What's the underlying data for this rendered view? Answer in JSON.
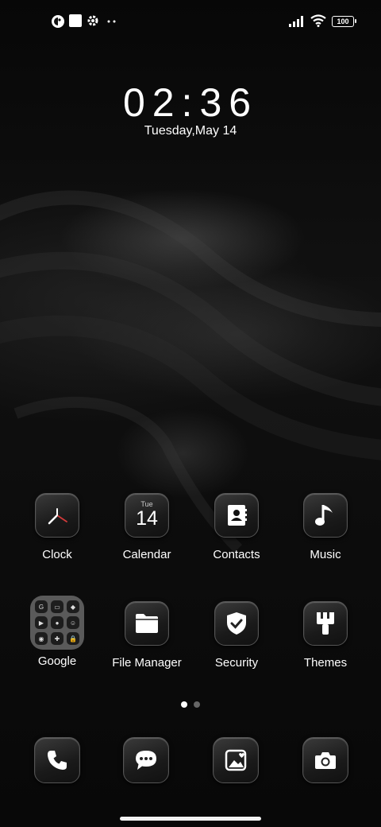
{
  "status_bar": {
    "battery": "100",
    "left_icons": [
      "theme-icon",
      "square-icon",
      "gear-icon",
      "more-dots-icon"
    ],
    "right_icons": [
      "signal-icon",
      "wifi-icon",
      "battery-icon"
    ]
  },
  "clock": {
    "time": "02:36",
    "date": "Tuesday,May 14"
  },
  "apps_row1": [
    {
      "label": "Clock",
      "icon": "clock-icon"
    },
    {
      "label": "Calendar",
      "icon": "calendar-icon",
      "day": "Tue",
      "num": "14"
    },
    {
      "label": "Contacts",
      "icon": "contacts-icon"
    },
    {
      "label": "Music",
      "icon": "music-note-icon"
    }
  ],
  "apps_row2": [
    {
      "label": "Google",
      "icon": "folder-icon"
    },
    {
      "label": "File Manager",
      "icon": "file-folder-icon"
    },
    {
      "label": "Security",
      "icon": "shield-icon"
    },
    {
      "label": "Themes",
      "icon": "brush-icon"
    }
  ],
  "folder_icons": [
    "G",
    "▭",
    "◆",
    "▶",
    "●",
    "☺",
    "◉",
    "✚",
    "🔒"
  ],
  "page_indicator": {
    "pages": 2,
    "current": 1
  },
  "dock": [
    "phone-icon",
    "messages-icon",
    "gallery-icon",
    "camera-icon"
  ],
  "colors": {
    "accent_red": "#d23a3a",
    "tile_bg": "#1c1c1c"
  }
}
